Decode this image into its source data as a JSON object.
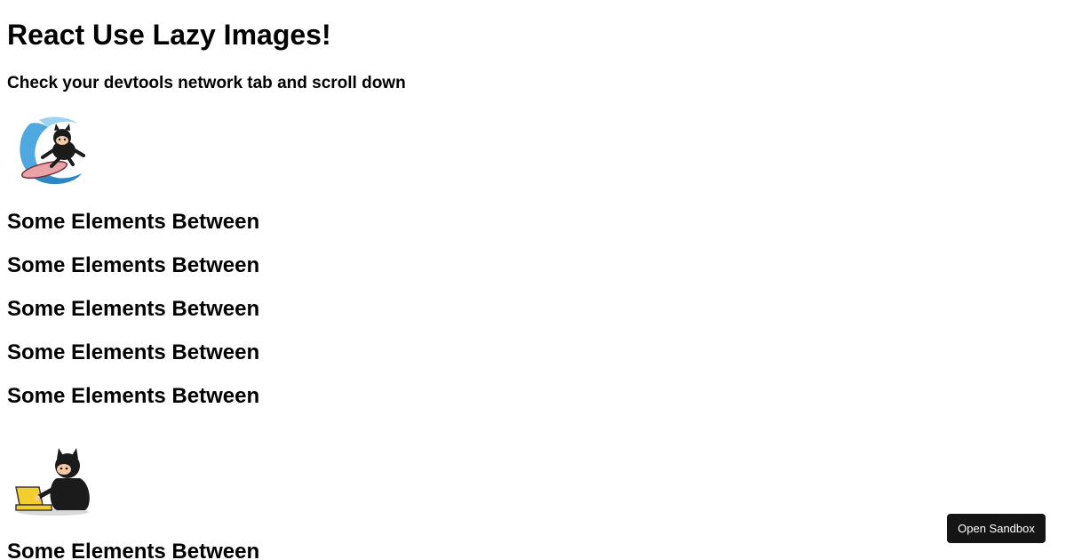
{
  "header": {
    "title": "React Use Lazy Images!",
    "subtitle": "Check your devtools network tab and scroll down"
  },
  "images": [
    {
      "icon": "octocat-surfer-icon"
    },
    {
      "icon": "octocat-laptop-icon"
    }
  ],
  "sections": {
    "between_label": "Some Elements Between",
    "group_one": [
      "Some Elements Between",
      "Some Elements Between",
      "Some Elements Between",
      "Some Elements Between",
      "Some Elements Between"
    ],
    "group_two": [
      "Some Elements Between"
    ]
  },
  "sandbox": {
    "button_label": "Open Sandbox"
  },
  "colors": {
    "button_bg": "#151515",
    "button_text": "#ffffff",
    "wave_blue": "#4fa9e0"
  }
}
